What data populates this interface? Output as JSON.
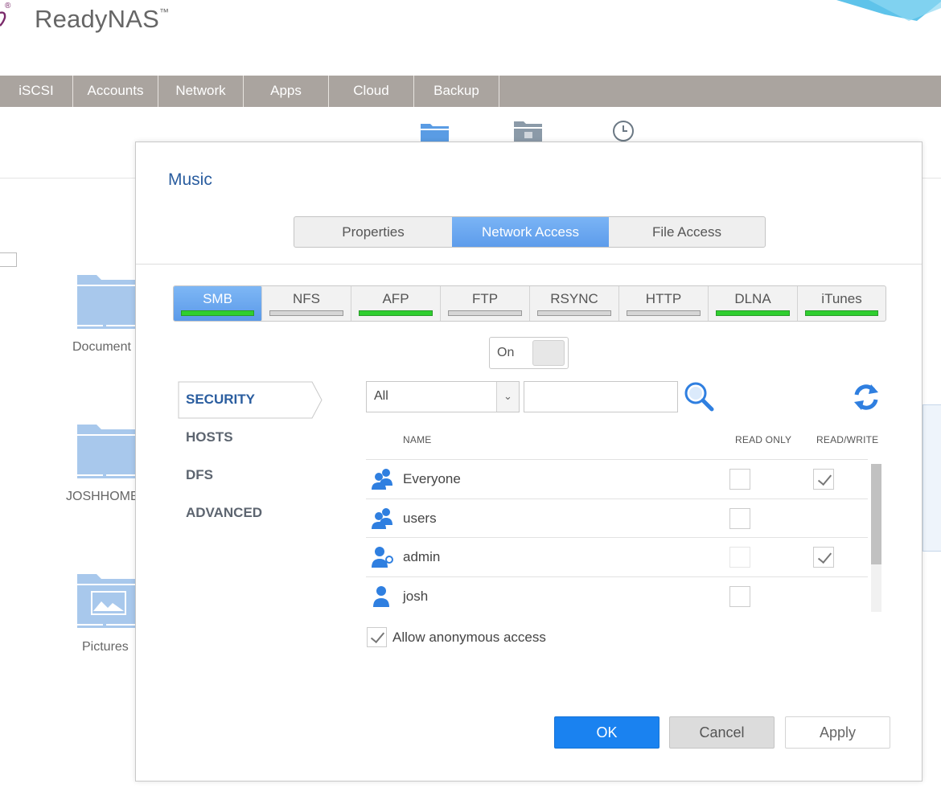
{
  "app": {
    "title": "ReadyNAS",
    "trademark": "™",
    "registered": "®"
  },
  "navbar": {
    "items": [
      "iSCSI",
      "Accounts",
      "Network",
      "Apps",
      "Cloud",
      "Backup"
    ]
  },
  "background": {
    "folders": [
      {
        "label": "Document"
      },
      {
        "label": "JOSHHOME"
      },
      {
        "label": "Pictures"
      }
    ],
    "folder_color": "#a8c8ec"
  },
  "dialog": {
    "title": "Music",
    "tabs": [
      "Properties",
      "Network Access",
      "File Access"
    ],
    "active_tab": "Network Access",
    "protocols": [
      {
        "label": "SMB",
        "enabled": true,
        "active": true
      },
      {
        "label": "NFS",
        "enabled": false,
        "active": false
      },
      {
        "label": "AFP",
        "enabled": true,
        "active": false
      },
      {
        "label": "FTP",
        "enabled": false,
        "active": false
      },
      {
        "label": "RSYNC",
        "enabled": false,
        "active": false
      },
      {
        "label": "HTTP",
        "enabled": false,
        "active": false
      },
      {
        "label": "DLNA",
        "enabled": true,
        "active": false
      },
      {
        "label": "iTunes",
        "enabled": true,
        "active": false
      }
    ],
    "toggle": {
      "label": "On"
    },
    "side_nav": [
      {
        "label": "SECURITY",
        "active": true
      },
      {
        "label": "HOSTS",
        "active": false
      },
      {
        "label": "DFS",
        "active": false
      },
      {
        "label": "ADVANCED",
        "active": false
      }
    ],
    "filter": {
      "selected": "All"
    },
    "search": {
      "placeholder": "",
      "value": ""
    },
    "columns": {
      "name": "NAME",
      "read_only": "READ ONLY",
      "read_write": "READ/WRITE"
    },
    "rows": [
      {
        "name": "Everyone",
        "icon": "group-icon",
        "read_only": false,
        "read_write": true
      },
      {
        "name": "users",
        "icon": "group-icon",
        "read_only": false,
        "read_write": false
      },
      {
        "name": "admin",
        "icon": "admin-user-icon",
        "read_only": false,
        "read_write": true
      },
      {
        "name": "josh",
        "icon": "user-icon",
        "read_only": false,
        "read_write": false
      }
    ],
    "anonymous": {
      "label": "Allow anonymous access",
      "checked": true
    },
    "buttons": {
      "ok": "OK",
      "cancel": "Cancel",
      "apply": "Apply"
    }
  },
  "colors": {
    "accent": "#1a82f0",
    "tab_active": "#6aa8f0",
    "indicator_on": "#2fcf2f",
    "navbar": "#aaa49f",
    "title_blue": "#2a5d9f",
    "icon_blue": "#2f7fe0"
  }
}
